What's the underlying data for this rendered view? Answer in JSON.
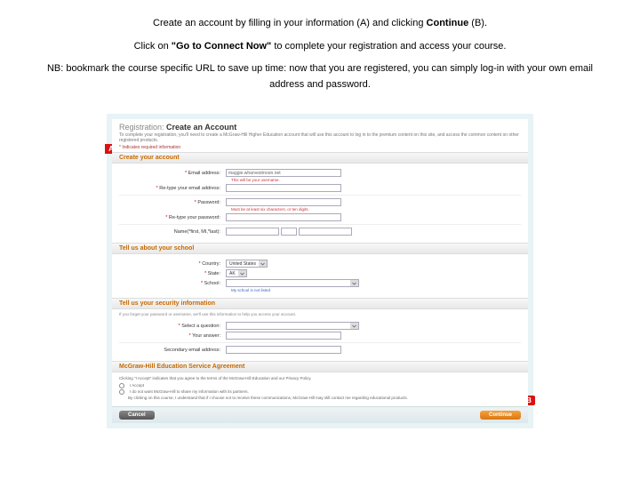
{
  "instructions": {
    "line1_a": "Create an account by filling in your information (A) and clicking ",
    "line1_b": "Continue",
    "line1_c": " (B).",
    "line2_a": "Click on ",
    "line2_b": "\"Go to Connect Now\"",
    "line2_c": " to complete your registration and access your course.",
    "line3": "NB: bookmark the course specific URL to save up time: now that you are registered, you can simply log-in  with your own email address and password."
  },
  "badges": {
    "a": "A",
    "b": "B"
  },
  "header": {
    "title_gray": "Registration: ",
    "title_black": "Create an Account",
    "sub": "To complete your registration, you'll need to create a McGraw-Hill Higher Education account that will use this account to log in to the premium content on this site, and access the common content on other registered products.",
    "req": "* Indicates required information"
  },
  "sections": {
    "s1": "Create your account",
    "s2": "Tell us about your school",
    "s3": "Tell us your security information",
    "s4": "McGraw-Hill Education Service Agreement"
  },
  "labels": {
    "email": "Email address:",
    "retype_email": "Re-type your email address:",
    "password": "Password:",
    "retype_password": "Re-type your password:",
    "name": "Name(*first, MI,*last):",
    "country": "Country:",
    "state": "State:",
    "school": "School:",
    "select_question": "Select a question:",
    "your_answer": "Your answer:",
    "secondary_email": "Secondary email address:"
  },
  "values": {
    "email_value": "maggie.wharvestmoon.net",
    "country": "United States",
    "state": "AK",
    "school_hint": "My school is not listed"
  },
  "hints": {
    "email_hint": "This will be your username.",
    "password_hint": "Must be at least six characters, or ten digits.",
    "security_hint": "If you forget your password or username, we'll use this information to help you access your account."
  },
  "agreement": {
    "line1": "Clicking \"I Accept\" indicates that you agree to the terms of the McGraw-Hill Education and our Privacy Policy.",
    "opt_accept": "I Accept",
    "opt_decline_a": "I do not want McGraw-Hill to share my information with its partners.",
    "opt_decline_b": "By clicking on this course, I understand that if I choose not to receive these communications, McGraw-Hill may still contact me regarding educational products."
  },
  "buttons": {
    "cancel": "Cancel",
    "continue": "Continue"
  }
}
